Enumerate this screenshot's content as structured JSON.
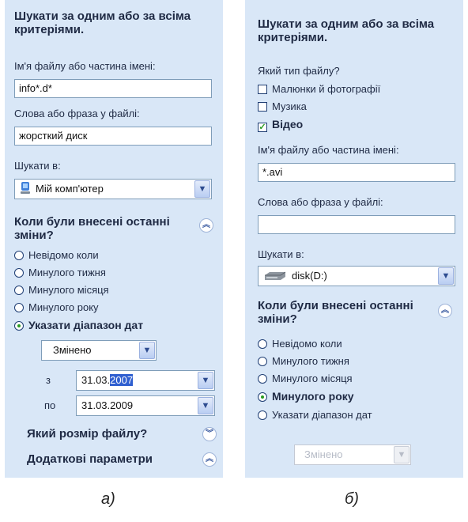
{
  "panel_a": {
    "search_heading": "Шукати за одним або за всіма критеріями.",
    "filename_label": "Ім'я файлу або частина імені:",
    "filename_value": "info*.d*",
    "phrase_label": "Слова або фраза у файлі:",
    "phrase_value": "жорсткий диск",
    "search_in_label": "Шукати в:",
    "search_in_value": "Мій комп'ютер",
    "modified_heading": "Коли були внесені останні зміни?",
    "modified_options": [
      "Невідомо коли",
      "Минулого тижня",
      "Минулого місяця",
      "Минулого року",
      "Указати діапазон дат"
    ],
    "selected_option": "Указати діапазон дат",
    "date_type_value": "Змінено",
    "from_label": "з",
    "from_date_prefix": "31.03.",
    "from_date_selected": "2007",
    "to_label": "по",
    "to_date": "31.03.2009",
    "size_heading": "Який розмір файлу?",
    "advanced_heading": "Додаткові параметри"
  },
  "panel_b": {
    "search_heading": "Шукати за одним або за всіма критеріями.",
    "file_type_label": "Який тип файлу?",
    "file_types": [
      {
        "label": "Малюнки й фотографії",
        "checked": false
      },
      {
        "label": "Музика",
        "checked": false
      },
      {
        "label": "Відео",
        "checked": true
      }
    ],
    "filename_label": "Ім'я файлу або частина імені:",
    "filename_value": "*.avi",
    "phrase_label": "Слова або фраза у файлі:",
    "phrase_value": "",
    "search_in_label": "Шукати в:",
    "search_in_value": "disk(D:)",
    "modified_heading": "Коли були внесені останні зміни?",
    "modified_options": [
      "Невідомо коли",
      "Минулого тижня",
      "Минулого місяця",
      "Минулого року",
      "Указати діапазон дат"
    ],
    "selected_option": "Минулого року",
    "date_type_value": "Змінено"
  },
  "captions": {
    "a": "а)",
    "b": "б)"
  },
  "icons": {
    "collapse_up": "double-chevron-up-icon",
    "expand_down": "double-chevron-down-icon",
    "dropdown": "chevron-down-icon",
    "computer": "computer-icon",
    "disk": "hard-disk-icon"
  },
  "colors": {
    "panel_bg": "#d9e7f7",
    "heading": "#1f2a44",
    "selection": "#2f5fd0",
    "radio_selected": "#2a9b22"
  }
}
